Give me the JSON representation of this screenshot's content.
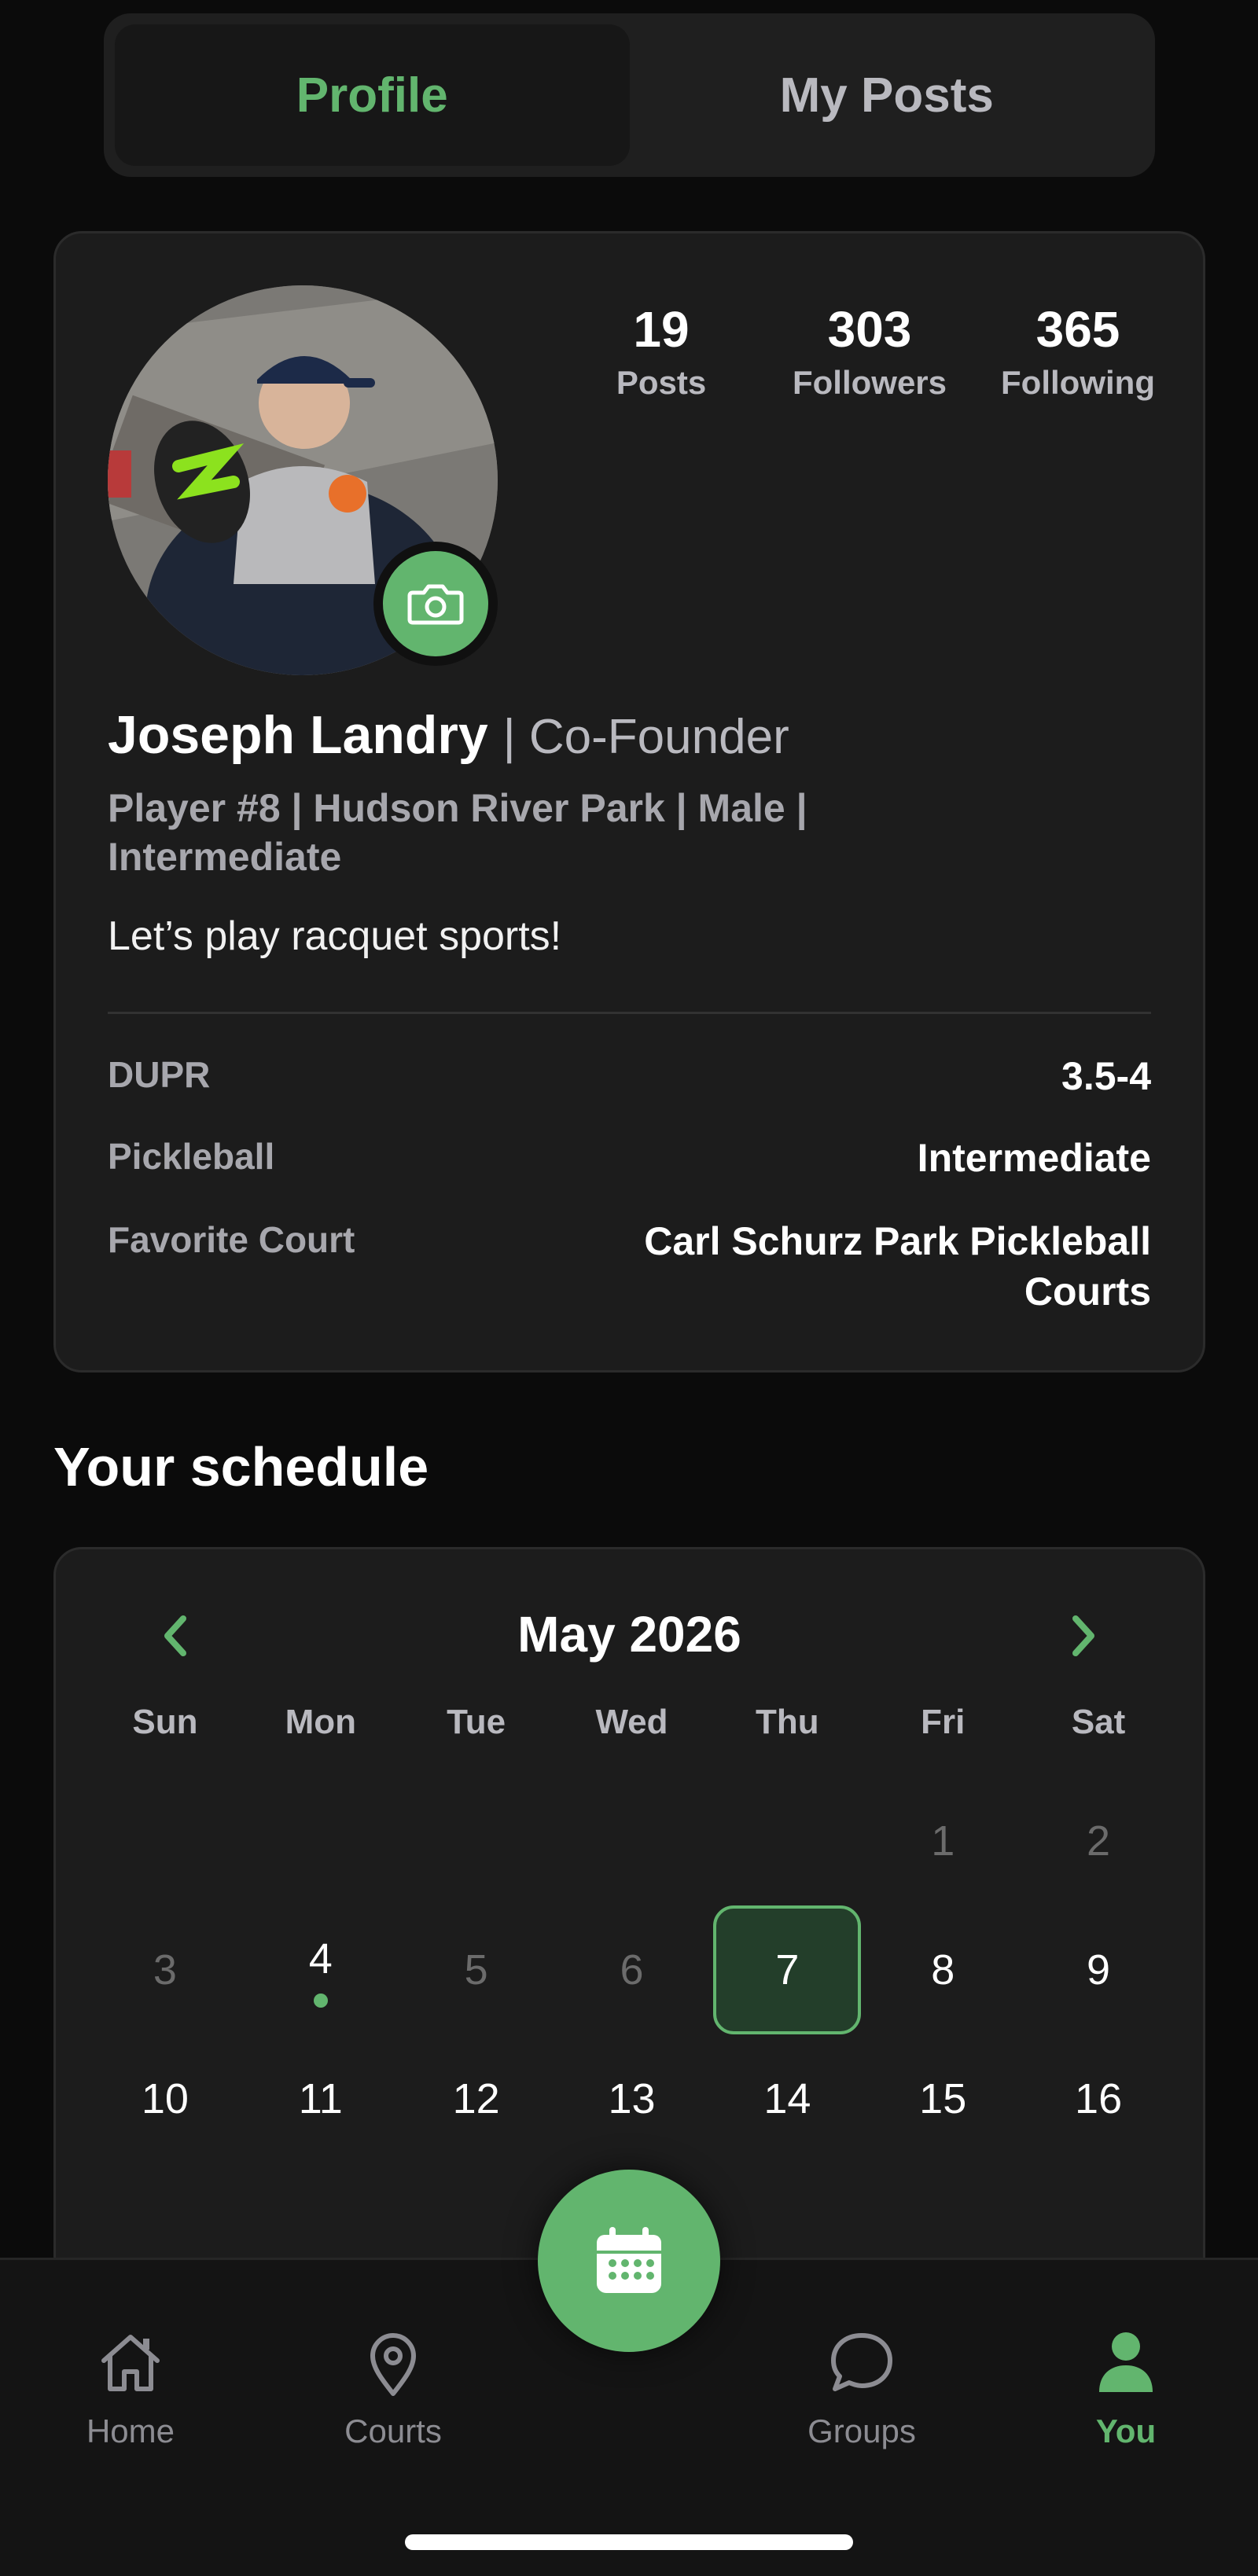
{
  "segment": {
    "tabs": [
      {
        "label": "Profile",
        "active": true
      },
      {
        "label": "My Posts",
        "active": false
      }
    ]
  },
  "profile": {
    "avatar_icon": "user-photo",
    "camera_icon": "camera-icon",
    "stats": [
      {
        "value": "19",
        "label": "Posts"
      },
      {
        "value": "303",
        "label": "Followers"
      },
      {
        "value": "365",
        "label": "Following"
      }
    ],
    "name": "Joseph Landry",
    "role": "| Co-Founder",
    "meta": "Player #8 | Hudson River Park | Male | Intermediate",
    "bio": "Let’s play racquet sports!",
    "details": [
      {
        "label": "DUPR",
        "value": "3.5-4"
      },
      {
        "label": "Pickleball",
        "value": "Intermediate"
      },
      {
        "label": "Favorite Court",
        "value": "Carl Schurz Park Pickleball Courts"
      }
    ]
  },
  "schedule": {
    "title": "Your schedule",
    "month": "May 2026",
    "weekdays": [
      "Sun",
      "Mon",
      "Tue",
      "Wed",
      "Thu",
      "Fri",
      "Sat"
    ],
    "weeks": [
      [
        "",
        "",
        "",
        "",
        "",
        "1",
        "2"
      ],
      [
        "3",
        "4",
        "5",
        "6",
        "7",
        "8",
        "9"
      ],
      [
        "10",
        "11",
        "12",
        "13",
        "14",
        "15",
        "16"
      ]
    ],
    "selected_day": "7",
    "event_days": [
      "4"
    ],
    "muted_days": [
      "1",
      "2",
      "3",
      "5",
      "6"
    ]
  },
  "tabbar": {
    "items": [
      {
        "label": "Home",
        "icon": "home-icon"
      },
      {
        "label": "Courts",
        "icon": "map-pin-icon"
      },
      {
        "label": "Groups",
        "icon": "chat-bubble-icon"
      },
      {
        "label": "You",
        "icon": "person-icon",
        "active": true
      }
    ],
    "fab_icon": "calendar-icon"
  },
  "colors": {
    "accent": "#62b56e",
    "background": "#0b0b0b",
    "card": "#1c1c1c"
  }
}
